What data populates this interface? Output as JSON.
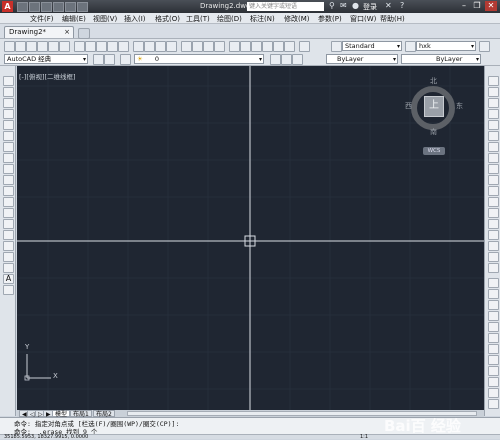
{
  "titlebar": {
    "title": "Drawing2.dwg",
    "search_placeholder": "键入关键字或短语",
    "login": "登录",
    "app_logo": "A",
    "minimize": "–",
    "restore": "❐",
    "close": "✕"
  },
  "menu": [
    "文件(F)",
    "编辑(E)",
    "视图(V)",
    "插入(I)",
    "格式(O)",
    "工具(T)",
    "绘图(D)",
    "标注(N)",
    "修改(M)",
    "参数(P)",
    "窗口(W)",
    "帮助(H)"
  ],
  "doc_tab": {
    "label": "Drawing2*",
    "close": "×"
  },
  "toolbar": {
    "workspace": "AutoCAD 经典",
    "layer": "0",
    "text_style": "Standard",
    "dim_style": "hxk",
    "color": "ByLayer",
    "linetype": "ByLayer",
    "lineweight": "ByLayer"
  },
  "canvas": {
    "viewport_label": "[-][俯视][二维线框]"
  },
  "viewcube": {
    "north": "北",
    "south": "南",
    "east": "东",
    "west": "西",
    "top": "上",
    "wcs": "WCS"
  },
  "ucs": {
    "x": "X",
    "y": "Y"
  },
  "layout_tabs": [
    "模型",
    "布局1",
    "布局2"
  ],
  "command": {
    "line1": "命令: 指定对角点或 [栏选(F)/圈围(WP)/圈交(CP)]:",
    "line2": "命令: _.erase 找到 9 个"
  },
  "status": {
    "coords": "35185.5953, 18327.9915, 0.0000",
    "scale": "1:1"
  },
  "watermark": "Bai百 经验"
}
